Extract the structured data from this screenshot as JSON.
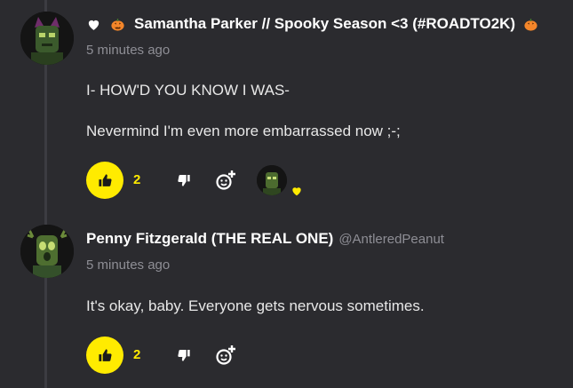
{
  "comments": [
    {
      "author": "Samantha Parker // Spooky Season <3 (#ROADTO2K)",
      "handle": "",
      "timestamp": "5 minutes ago",
      "lines": [
        "I- HOW'D YOU KNOW I WAS-",
        "Nevermind I'm even more embarrassed now ;-;"
      ],
      "likes": "2",
      "badges": [
        "white-heart",
        "jack-o-lantern"
      ]
    },
    {
      "author": "Penny Fitzgerald (THE REAL ONE)",
      "handle": "@AntleredPeanut",
      "timestamp": "5 minutes ago",
      "lines": [
        "It's okay, baby. Everyone gets nervous sometimes."
      ],
      "likes": "2"
    }
  ],
  "colors": {
    "background": "#2b2b2f",
    "accent": "#ffeb00",
    "muted": "#8e8e95"
  }
}
